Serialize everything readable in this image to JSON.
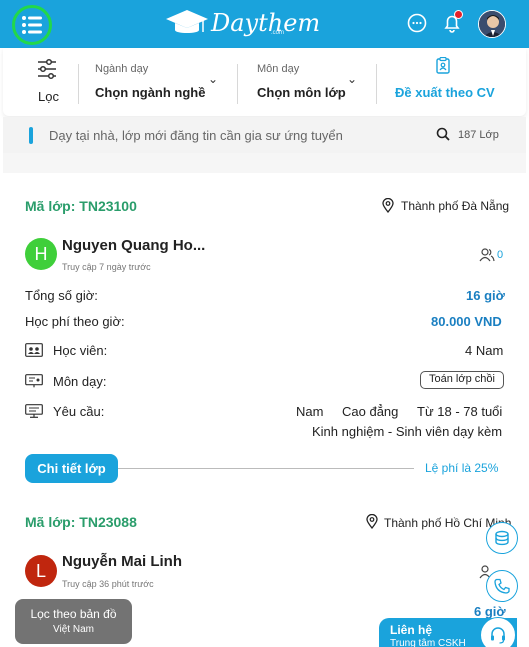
{
  "header": {
    "logo_text": "Daythem",
    "logo_sub": ".com",
    "accent_color": "#1aa3dc"
  },
  "filters": {
    "location_label": "Lọc",
    "subject_area_caption": "Ngành dạy",
    "subject_area_value": "Chọn ngành nghề",
    "subject_caption": "Môn dạy",
    "subject_value": "Chọn môn lớp",
    "cv_suggest_label": "Đề xuất theo CV"
  },
  "search": {
    "placeholder": "Dạy tại nhà, lớp mới đăng tin cần gia sư ứng tuyển",
    "count": "187 Lớp"
  },
  "classes": [
    {
      "code": "Mã lớp: TN23100",
      "city": "Thành phố Đà Nẵng",
      "tutor_initial": "H",
      "tutor_color": "#3fcf3a",
      "tutor_name": "Nguyen Quang Ho...",
      "access": "Truy cập 7 ngày trước",
      "applicants": "0",
      "total_hours_label": "Tổng số giờ:",
      "total_hours": "16 giờ",
      "fee_label": "Học phí theo giờ:",
      "fee": "80.000 VND",
      "students_label": "Học viên:",
      "students": "4 Nam",
      "subject_label": "Môn dạy:",
      "subject": "Toán lớp chồi",
      "req_label": "Yêu cầu:",
      "req_gender": "Nam",
      "req_level": "Cao đẳng",
      "req_age": "Từ 18 - 78 tuổi",
      "req_exp": "Kinh nghiệm - Sinh viên dạy kèm",
      "detail_button": "Chi tiết lớp",
      "fee_rate": "Lệ phí là 25%"
    },
    {
      "code": "Mã lớp: TN23088",
      "city": "Thành phố Hồ Chí Minh",
      "tutor_initial": "L",
      "tutor_color": "#c0260e",
      "tutor_name": "Nguyễn Mai Linh",
      "access": "Truy cập 36 phút trước",
      "applicants": "",
      "total_hours": "6 giờ"
    }
  ],
  "floating": {
    "map_filter_title": "Lọc theo bản đồ",
    "map_filter_region": "Việt Nam",
    "contact_title": "Liên hệ",
    "contact_sub": "Trung tâm CSKH"
  }
}
